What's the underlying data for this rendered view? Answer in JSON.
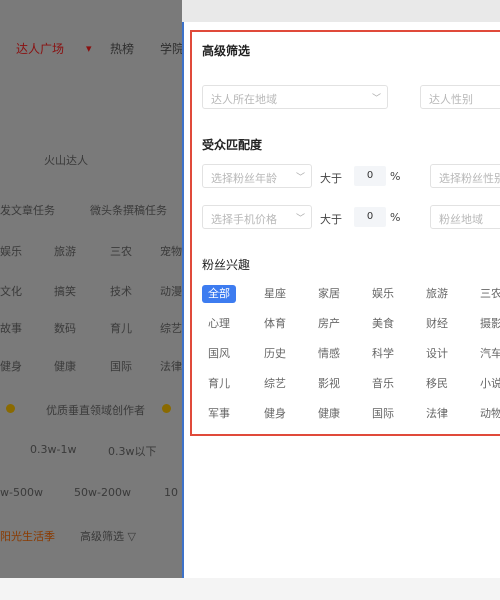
{
  "background": {
    "nav": [
      "达人广场",
      "热榜",
      "学院"
    ],
    "rows": [
      [
        "火山达人"
      ],
      [
        "发文章任务",
        "微头条撰稿任务"
      ],
      [
        "娱乐",
        "旅游",
        "三农",
        "宠物"
      ],
      [
        "文化",
        "搞笑",
        "技术",
        "动漫"
      ],
      [
        "故事",
        "数码",
        "育儿",
        "综艺"
      ],
      [
        "健身",
        "健康",
        "国际",
        "法律"
      ],
      [
        "优质垂直领域创作者"
      ],
      [
        "0.3w-1w",
        "0.3w以下"
      ],
      [
        "w-500w",
        "50w-200w",
        "10"
      ],
      [
        "阳光生活季",
        "高级筛选 ▽"
      ]
    ]
  },
  "panel": {
    "title": "高级筛选",
    "region_placeholder": "达人所在地域",
    "gender_placeholder": "达人性别",
    "audience_title": "受众匹配度",
    "age_placeholder": "选择粉丝年龄",
    "gender2_placeholder": "选择粉丝性别",
    "phone_placeholder": "选择手机价格",
    "fans_region_placeholder": "粉丝地域",
    "greater_than": "大于",
    "age_value": "0",
    "phone_value": "0",
    "percent": "%",
    "interest_title": "粉丝兴趣",
    "interests": [
      [
        "全部",
        "星座",
        "家居",
        "娱乐",
        "旅游",
        "三农"
      ],
      [
        "心理",
        "体育",
        "房产",
        "美食",
        "财经",
        "摄影"
      ],
      [
        "国风",
        "历史",
        "情感",
        "科学",
        "设计",
        "汽车"
      ],
      [
        "育儿",
        "综艺",
        "影视",
        "音乐",
        "移民",
        "小说"
      ],
      [
        "军事",
        "健身",
        "健康",
        "国际",
        "法律",
        "动物"
      ]
    ]
  },
  "colors": {
    "accent": "#3d7cf0",
    "highlight_border": "#e04a3a",
    "overlay": "#7a7a7a"
  }
}
